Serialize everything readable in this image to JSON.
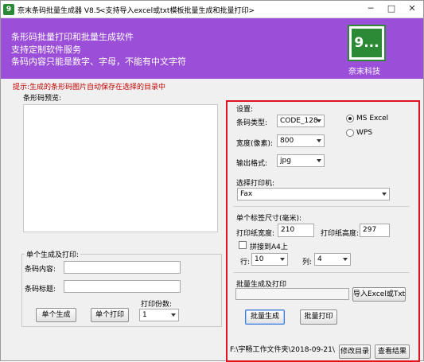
{
  "window": {
    "title": "奈末条码批量生成器 V8.5",
    "subtitle": "<支持导入excel或txt模板批量生成和批量打印>",
    "minimize_glyph": "─",
    "maximize_glyph": "□",
    "close_glyph": "✕",
    "icon_glyph": "9"
  },
  "banner": {
    "lines": [
      "条形码批量打印和批量生成软件",
      "支持定制软件服务",
      "条码内容只能是数字、字母，不能有中文字符"
    ],
    "logo_glyph": "9...",
    "logo_text": "奈末科技"
  },
  "hint": "提示:生成的条形码图片自动保存在选择的目录中",
  "preview": {
    "label": "条形码预览:"
  },
  "single": {
    "group_title": "单个生成及打印:",
    "content_label": "条码内容:",
    "content_value": "",
    "title_label": "条码标题:",
    "title_value": "",
    "copies_label": "打印份数:",
    "copies_value": "1",
    "generate_label": "单个生成",
    "print_label": "单个打印"
  },
  "settings": {
    "title": "设置:",
    "type_label": "条码类型:",
    "type_value": "CODE_128",
    "width_label": "宽度(像素):",
    "width_value": "800",
    "format_label": "输出格式:",
    "format_value": "jpg",
    "radio_ms": "MS  Excel",
    "radio_wps": "WPS",
    "printer_label": "选择打印机:",
    "printer_value": "Fax",
    "label_size_title": "单个标签尺寸(毫米):",
    "paper_width_label": "打印纸宽度:",
    "paper_width_value": "210",
    "paper_height_label": "打印纸高度:",
    "paper_height_value": "297",
    "a4_label": "拼接到A4上",
    "rows_label": "行:",
    "rows_value": "10",
    "cols_label": "列:",
    "cols_value": "4"
  },
  "batch": {
    "title": "批量生成及打印",
    "path_value": "",
    "import_label": "导入Excel或Txt",
    "generate_label": "批量生成",
    "print_label": "批量打印",
    "output_path": "F:\\宇畅工作文件夹\\2018-09-21\\莎",
    "change_dir_label": "修改目录",
    "view_result_label": "查看结果"
  }
}
